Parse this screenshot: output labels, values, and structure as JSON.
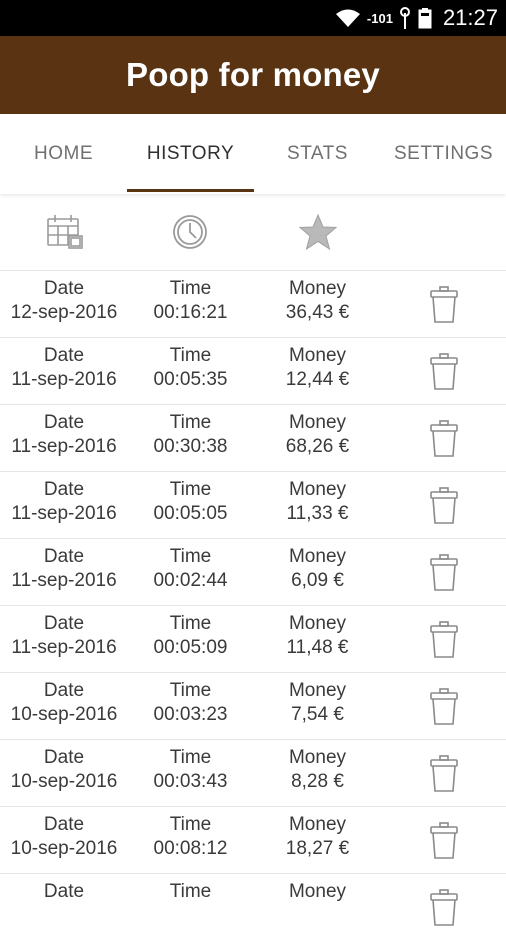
{
  "status": {
    "signal": "-101",
    "time": "21:27"
  },
  "app": {
    "title": "Poop for money"
  },
  "tabs": [
    {
      "label": "HOME"
    },
    {
      "label": "HISTORY"
    },
    {
      "label": "STATS"
    },
    {
      "label": "SETTINGS"
    }
  ],
  "header_icons": [
    "calendar-icon",
    "clock-icon",
    "star-icon"
  ],
  "rows": [
    {
      "date_label": "Date",
      "date": "12-sep-2016",
      "time_label": "Time",
      "time": "00:16:21",
      "money_label": "Money",
      "money": "36,43  €"
    },
    {
      "date_label": "Date",
      "date": "11-sep-2016",
      "time_label": "Time",
      "time": "00:05:35",
      "money_label": "Money",
      "money": "12,44  €"
    },
    {
      "date_label": "Date",
      "date": "11-sep-2016",
      "time_label": "Time",
      "time": "00:30:38",
      "money_label": "Money",
      "money": "68,26  €"
    },
    {
      "date_label": "Date",
      "date": "11-sep-2016",
      "time_label": "Time",
      "time": "00:05:05",
      "money_label": "Money",
      "money": "11,33  €"
    },
    {
      "date_label": "Date",
      "date": "11-sep-2016",
      "time_label": "Time",
      "time": "00:02:44",
      "money_label": "Money",
      "money": "6,09  €"
    },
    {
      "date_label": "Date",
      "date": "11-sep-2016",
      "time_label": "Time",
      "time": "00:05:09",
      "money_label": "Money",
      "money": "11,48  €"
    },
    {
      "date_label": "Date",
      "date": "10-sep-2016",
      "time_label": "Time",
      "time": "00:03:23",
      "money_label": "Money",
      "money": "7,54  €"
    },
    {
      "date_label": "Date",
      "date": "10-sep-2016",
      "time_label": "Time",
      "time": "00:03:43",
      "money_label": "Money",
      "money": "8,28  €"
    },
    {
      "date_label": "Date",
      "date": "10-sep-2016",
      "time_label": "Time",
      "time": "00:08:12",
      "money_label": "Money",
      "money": "18,27  €"
    },
    {
      "date_label": "Date",
      "date": "",
      "time_label": "Time",
      "time": "",
      "money_label": "Money",
      "money": ""
    }
  ],
  "colors": {
    "appbar": "#5a3412",
    "accent": "#5a3412",
    "statusbar": "#000000"
  }
}
